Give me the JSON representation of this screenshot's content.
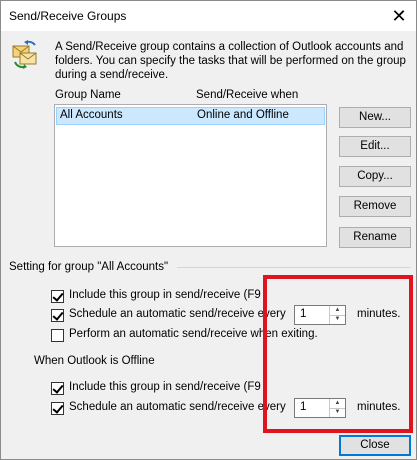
{
  "window": {
    "title": "Send/Receive Groups",
    "close_glyph": "✕"
  },
  "description": "A Send/Receive group contains a collection of Outlook accounts and folders. You can specify the tasks that will be performed on the group during a send/receive.",
  "list": {
    "headers": [
      "Group Name",
      "Send/Receive when"
    ],
    "rows": [
      {
        "name": "All Accounts",
        "when": "Online and Offline",
        "selected": true
      }
    ]
  },
  "buttons": {
    "new": "New...",
    "edit": "Edit...",
    "copy": "Copy...",
    "remove": "Remove",
    "rename": "Rename",
    "close": "Close"
  },
  "settings": {
    "group_label": "Setting for group \"All Accounts\"",
    "online": {
      "include": {
        "label": "Include this group in send/receive (F9",
        "checked": true
      },
      "schedule": {
        "label": "Schedule an automatic send/receive every",
        "checked": true,
        "value": "1",
        "unit": "minutes."
      },
      "exit": {
        "label": "Perform an automatic send/receive when exiting.",
        "checked": false
      }
    },
    "offline_label": "When Outlook is Offline",
    "offline": {
      "include": {
        "label": "Include this group in send/receive (F9",
        "checked": true
      },
      "schedule": {
        "label": "Schedule an automatic send/receive every",
        "checked": true,
        "value": "1",
        "unit": "minutes."
      }
    }
  },
  "annotation": {
    "color": "#e0141e"
  },
  "icons": {
    "app": "send-receive-icon",
    "close": "close-icon",
    "spin_up": "▲",
    "spin_down": "▼"
  }
}
